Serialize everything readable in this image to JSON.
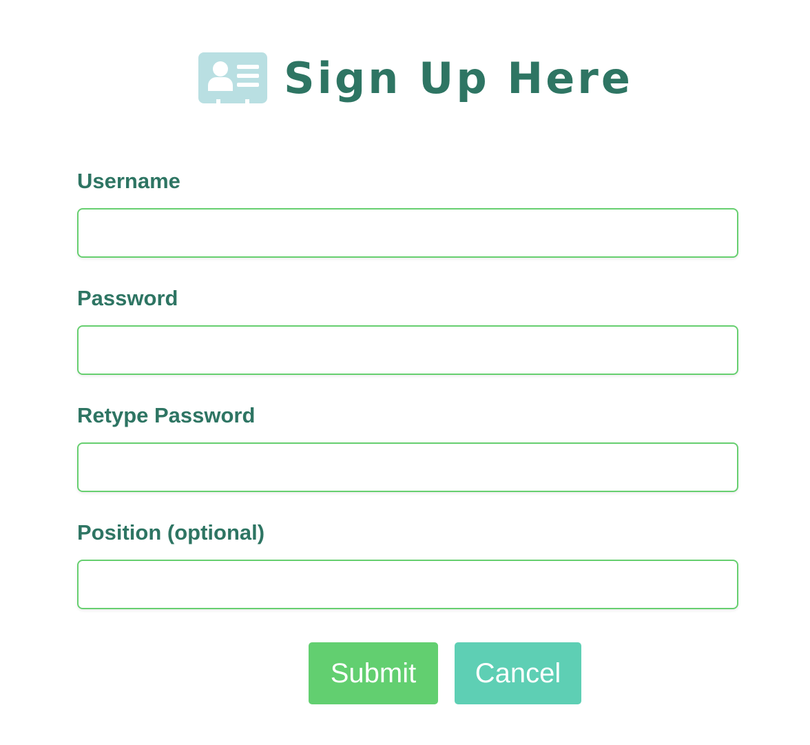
{
  "header": {
    "title": "Sign Up Here",
    "icon": "id-card-icon",
    "icon_color": "#b9dfe2"
  },
  "form": {
    "fields": [
      {
        "label": "Username",
        "value": "",
        "placeholder": ""
      },
      {
        "label": "Password",
        "value": "",
        "placeholder": ""
      },
      {
        "label": "Retype Password",
        "value": "",
        "placeholder": ""
      },
      {
        "label": "Position (optional)",
        "value": "",
        "placeholder": ""
      }
    ]
  },
  "actions": {
    "submit_label": "Submit",
    "cancel_label": "Cancel"
  },
  "colors": {
    "title": "#2e7563",
    "input_border": "#66cf6f",
    "submit_bg": "#62cf70",
    "cancel_bg": "#5ecfb4"
  }
}
